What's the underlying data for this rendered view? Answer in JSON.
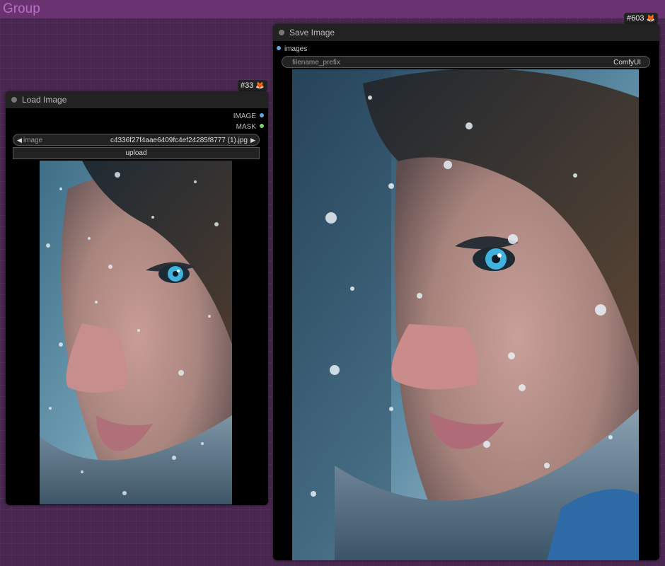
{
  "group": {
    "title": "Group"
  },
  "load_node": {
    "badge": "#33",
    "title": "Load Image",
    "outputs": [
      {
        "label": "IMAGE",
        "color": "#5aa9e6"
      },
      {
        "label": "MASK",
        "color": "#7ccf6a"
      }
    ],
    "image_widget": {
      "label": "image",
      "value": "c4336f27f4aae6409fc4ef24285f8777 (1).jpg"
    },
    "upload_label": "upload"
  },
  "save_node": {
    "badge": "#603",
    "title": "Save Image",
    "input": {
      "label": "images",
      "color": "#5aa9e6"
    },
    "prefix_widget": {
      "label": "filename_prefix",
      "value": "ComfyUI"
    }
  },
  "icons": {
    "badge_icon": "fox-icon",
    "collapse_icon": "collapse-dot-icon",
    "prev_arrow": "left-arrow-icon",
    "next_arrow": "right-arrow-icon"
  },
  "colors": {
    "canvas": "#4a2750",
    "group_header": "#6a3271",
    "group_title": "#b86fc4",
    "node_title_bg": "#222222",
    "image_slot": "#5aa9e6",
    "mask_slot": "#7ccf6a"
  }
}
